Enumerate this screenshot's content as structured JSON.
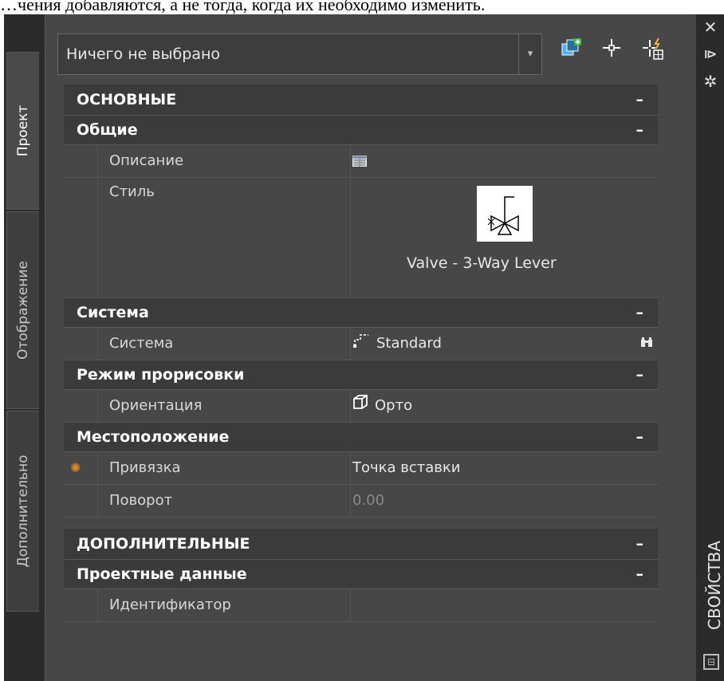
{
  "caption": "…чения добавляются, а не тогда, когда их необходимо изменить.",
  "tabs": {
    "project": "Проект",
    "display": "Отображение",
    "extra": "Дополнительно"
  },
  "right_bar": {
    "close": "✕",
    "pin": "⧐",
    "settings": "✲",
    "title": "СВОЙСТВА",
    "bottom": "⊟"
  },
  "selector": {
    "value": "Ничего не выбрано",
    "arrow": "▾"
  },
  "toolbar": {
    "add_icon": "⊞",
    "pick_icon": "⌖",
    "quick_icon": "⚡"
  },
  "sections": {
    "main": "ОСНОВНЫЕ",
    "general": "Общие",
    "system": "Система",
    "mode": "Режим прорисовки",
    "location": "Местоположение",
    "extra": "ДОПОЛНИТЕЛЬНЫЕ",
    "project_data": "Проектные данные",
    "minus": "–"
  },
  "rows": {
    "description": {
      "label": "Описание"
    },
    "style": {
      "label": "Стиль",
      "value": "Valve - 3-Way Lever"
    },
    "system": {
      "label": "Система",
      "value": "Standard"
    },
    "orientation": {
      "label": "Ориентация",
      "value": "Орто"
    },
    "anchor": {
      "label": "Привязка",
      "value": "Точка вставки"
    },
    "rotation": {
      "label": "Поворот",
      "value": "0.00"
    },
    "identifier": {
      "label": "Идентификатор",
      "value": ""
    }
  },
  "colors": {
    "panel": "#474747",
    "header": "#3b3b3b",
    "frame": "#2b2b2b",
    "accent": "#e08a2a"
  }
}
